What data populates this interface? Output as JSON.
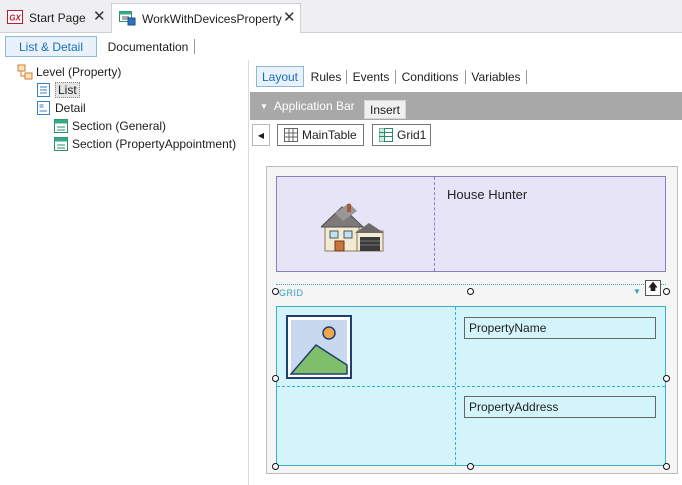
{
  "doc_tabs": [
    {
      "label": "Start Page",
      "icon": "gx-logo-icon"
    },
    {
      "label": "WorkWithDevicesProperty",
      "icon": "work-with-devices-icon"
    }
  ],
  "sub_tabs": {
    "list_detail": "List & Detail",
    "documentation": "Documentation"
  },
  "tree": {
    "root": "Level (Property)",
    "list": "List",
    "detail": "Detail",
    "section_general": "Section (General)",
    "section_appointment": "Section (PropertyAppointment)"
  },
  "inner_tabs": [
    "Layout",
    "Rules",
    "Events",
    "Conditions",
    "Variables"
  ],
  "app_bar": {
    "label": "Application Bar",
    "insert": "Insert"
  },
  "breadcrumb": {
    "maintable": "MainTable",
    "grid": "Grid1"
  },
  "canvas": {
    "app_title": "House Hunter",
    "grid_label": "GRID",
    "attr_name": "PropertyName",
    "attr_address": "PropertyAddress"
  },
  "colors": {
    "maintable_bg": "#e8e4f7",
    "grid_bg": "#d2f4fa",
    "accent": "#1a6fb8",
    "app_bar": "#a8a8a8"
  }
}
